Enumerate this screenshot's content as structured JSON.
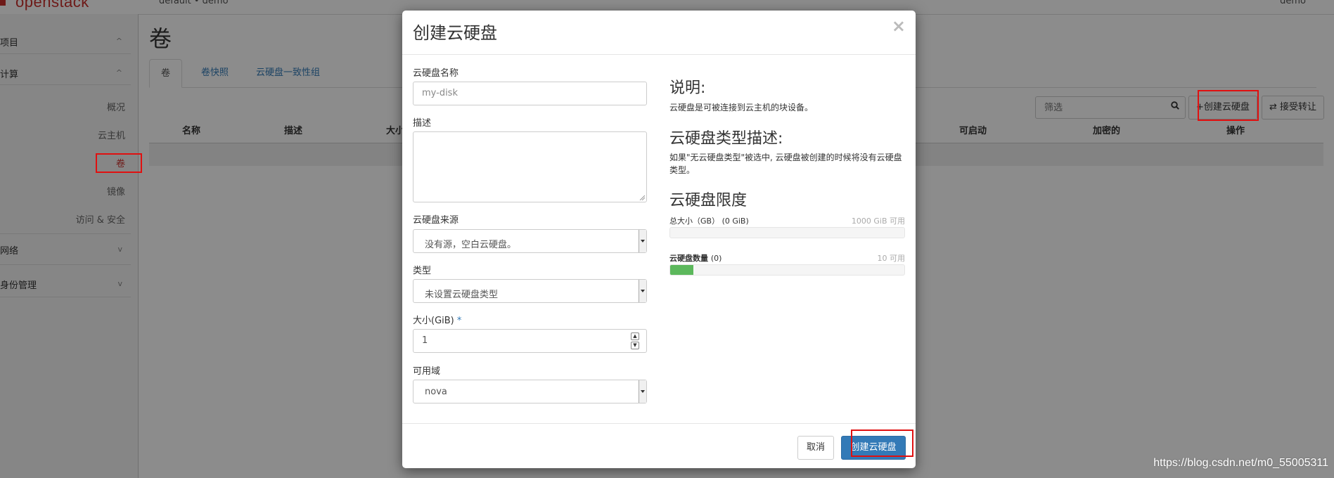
{
  "topbar": {
    "logo_text": "openstack",
    "project_switch": "default • demo",
    "user_menu": "demo"
  },
  "sidebar": {
    "project": "项目",
    "compute": "计算",
    "compute_items": [
      "概况",
      "云主机",
      "卷",
      "镜像",
      "访问 & 安全"
    ],
    "network": "网络",
    "identity": "身份管理"
  },
  "page": {
    "title": "卷",
    "tabs": [
      "卷",
      "卷快照",
      "云硬盘一致性组"
    ],
    "filter_placeholder": "筛选",
    "create_button": "创建云硬盘",
    "accept_transfer_button": "接受转让",
    "columns": [
      "名称",
      "描述",
      "大小",
      "可启动",
      "加密的",
      "操作"
    ]
  },
  "modal": {
    "title": "创建云硬盘",
    "close": "×",
    "name_label": "云硬盘名称",
    "name_placeholder": "my-disk",
    "description_label": "描述",
    "source_label": "云硬盘来源",
    "source_value": "没有源，空白云硬盘。",
    "type_label": "类型",
    "type_value": "未设置云硬盘类型",
    "size_label": "大小(GiB)",
    "size_required": "*",
    "size_value": "1",
    "az_label": "可用域",
    "az_value": "nova",
    "info_heading": "说明:",
    "info_text": "云硬盘是可被连接到云主机的块设备。",
    "type_desc_heading": "云硬盘类型描述:",
    "type_desc_text": "如果\"无云硬盘类型\"被选中, 云硬盘被创建的时候将没有云硬盘类型。",
    "limits_heading": "云硬盘限度",
    "quota_size_label": "总大小（GB） (0 GiB)",
    "quota_size_available": "1000 GiB 可用",
    "quota_size_fraction": 0.0,
    "quota_count_label": "云硬盘数量",
    "quota_count_value": "(0)",
    "quota_count_available": "10 可用",
    "quota_count_fraction": 0.1,
    "cancel_button": "取消",
    "submit_button": "创建云硬盘"
  },
  "colors": {
    "primary": "#337ab7",
    "success": "#5cb85c",
    "highlight": "#e01010",
    "brand": "#c9302c"
  },
  "watermark": "https://blog.csdn.net/m0_55005311"
}
